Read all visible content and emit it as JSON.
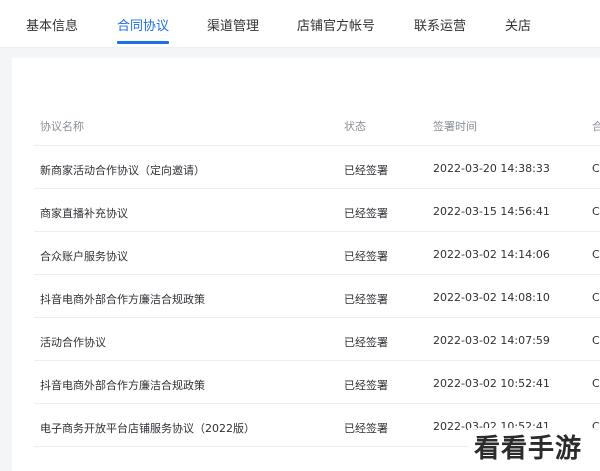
{
  "tabs": [
    {
      "label": "基本信息",
      "active": false
    },
    {
      "label": "合同协议",
      "active": true
    },
    {
      "label": "渠道管理",
      "active": false
    },
    {
      "label": "店铺官方帐号",
      "active": false
    },
    {
      "label": "联系运营",
      "active": false
    },
    {
      "label": "关店",
      "active": false
    }
  ],
  "table": {
    "headers": {
      "name": "协议名称",
      "status": "状态",
      "time": "签署时间",
      "op": "合"
    },
    "rows": [
      {
        "name": "新商家活动合作协议（定向邀请）",
        "status": "已经签署",
        "time": "2022-03-20 14:38:33",
        "op": "C"
      },
      {
        "name": "商家直播补充协议",
        "status": "已经签署",
        "time": "2022-03-15 14:56:41",
        "op": "C"
      },
      {
        "name": "合众账户服务协议",
        "status": "已经签署",
        "time": "2022-03-02 14:14:06",
        "op": "C"
      },
      {
        "name": "抖音电商外部合作方廉洁合规政策",
        "status": "已经签署",
        "time": "2022-03-02 14:08:10",
        "op": "C"
      },
      {
        "name": "活动合作协议",
        "status": "已经签署",
        "time": "2022-03-02 14:07:59",
        "op": "C"
      },
      {
        "name": "抖音电商外部合作方廉洁合规政策",
        "status": "已经签署",
        "time": "2022-03-02 10:52:41",
        "op": "C"
      },
      {
        "name": "电子商务开放平台店铺服务协议（2022版）",
        "status": "已经签署",
        "time": "2022-03-02 10:52:41",
        "op": "C"
      }
    ]
  },
  "watermark": "看看手游网",
  "colors": {
    "accent": "#1e6fe8",
    "text": "#2f3136",
    "muted": "#8a8f99",
    "background": "#f4f5f7"
  }
}
